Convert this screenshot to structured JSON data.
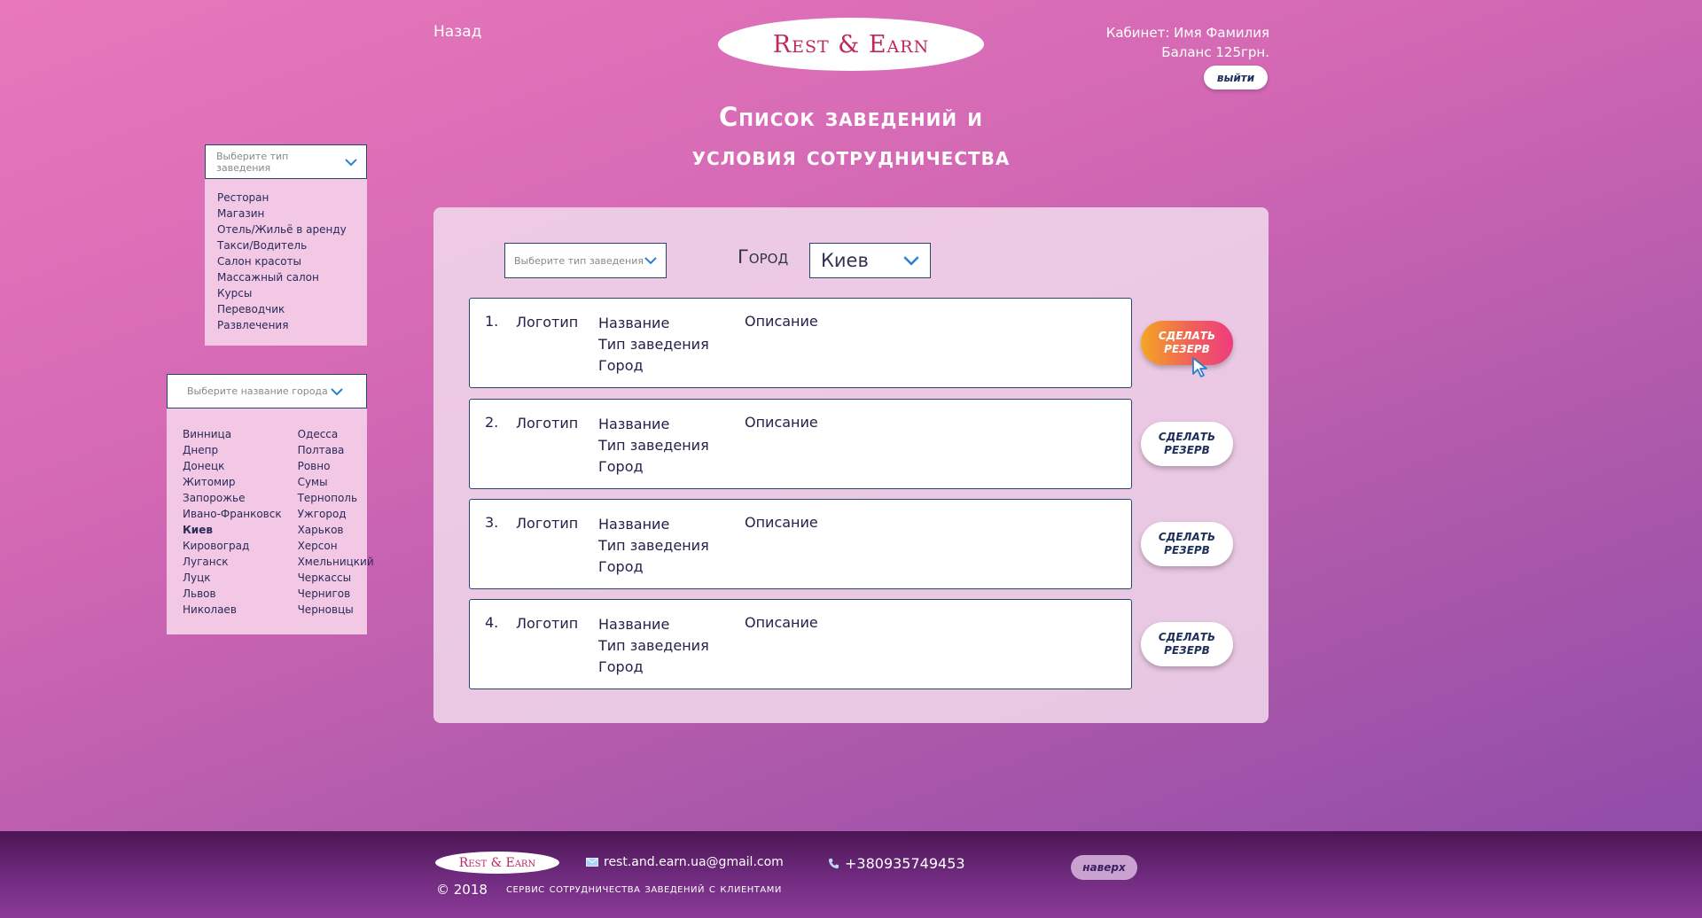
{
  "header": {
    "back_label": "Назад",
    "logo_text": "Rest & Earn",
    "cabinet_label": "Кабинет: Имя Фамилия",
    "balance_label": "Баланс 125грн.",
    "logout_label": "выйти",
    "title_line1": "Список заведений и",
    "title_line2": "условия сотрудничества"
  },
  "side_type_filter": {
    "placeholder": "Выберите тип заведения",
    "items": [
      "Ресторан",
      "Магазин",
      "Отель/Жильё в аренду",
      "Такси/Водитель",
      "Салон красоты",
      "Массажный салон",
      "Курсы",
      "Переводчик",
      "Развлечения"
    ]
  },
  "side_city_filter": {
    "placeholder": "Выберите название города",
    "col1": [
      "Винница",
      "Днепр",
      "Донецк",
      "Житомир",
      "Запорожье",
      "Ивано-Франковск",
      "Киев",
      "Кировоград",
      "Луганск",
      "Луцк",
      "Львов",
      "Николаев"
    ],
    "col2": [
      "Одесса",
      "Полтава",
      "Ровно",
      "Сумы",
      "Тернополь",
      "Ужгород",
      "Харьков",
      "Херсон",
      "Хмельницкий",
      "Черкассы",
      "Чернигов",
      "Черновцы"
    ],
    "selected": "Киев"
  },
  "main": {
    "type_placeholder": "Выберите тип заведения",
    "city_label": "Город",
    "city_value": "Киев",
    "cards": [
      {
        "num": "1.",
        "logo": "Логотип",
        "name": "Название",
        "type": "Тип заведения",
        "city": "Город",
        "desc": "Описание",
        "button": "Сделать резерв"
      },
      {
        "num": "2.",
        "logo": "Логотип",
        "name": "Название",
        "type": "Тип заведения",
        "city": "Город",
        "desc": "Описание",
        "button": "Сделать резерв"
      },
      {
        "num": "3.",
        "logo": "Логотип",
        "name": "Название",
        "type": "Тип заведения",
        "city": "Город",
        "desc": "Описание",
        "button": "Сделать резерв"
      },
      {
        "num": "4.",
        "logo": "Логотип",
        "name": "Название",
        "type": "Тип заведения",
        "city": "Город",
        "desc": "Описание",
        "button": "Сделать резерв"
      }
    ]
  },
  "footer": {
    "logo_text": "Rest & Earn",
    "email": "rest.and.earn.ua@gmail.com",
    "phone": "+380935749453",
    "top_label": "наверх",
    "copyright": "© 2018",
    "slogan": "сервис сотрудничества заведений с клиентами"
  },
  "icons": {
    "chevron": "chevron-down-icon",
    "mail": "mail-icon",
    "phone": "phone-icon",
    "cursor": "cursor-icon"
  },
  "colors": {
    "accent_gradient_start": "#f5a623",
    "accent_gradient_end": "#ee3c7e",
    "logo_red": "#c0265f",
    "border_navy": "#29456d"
  }
}
